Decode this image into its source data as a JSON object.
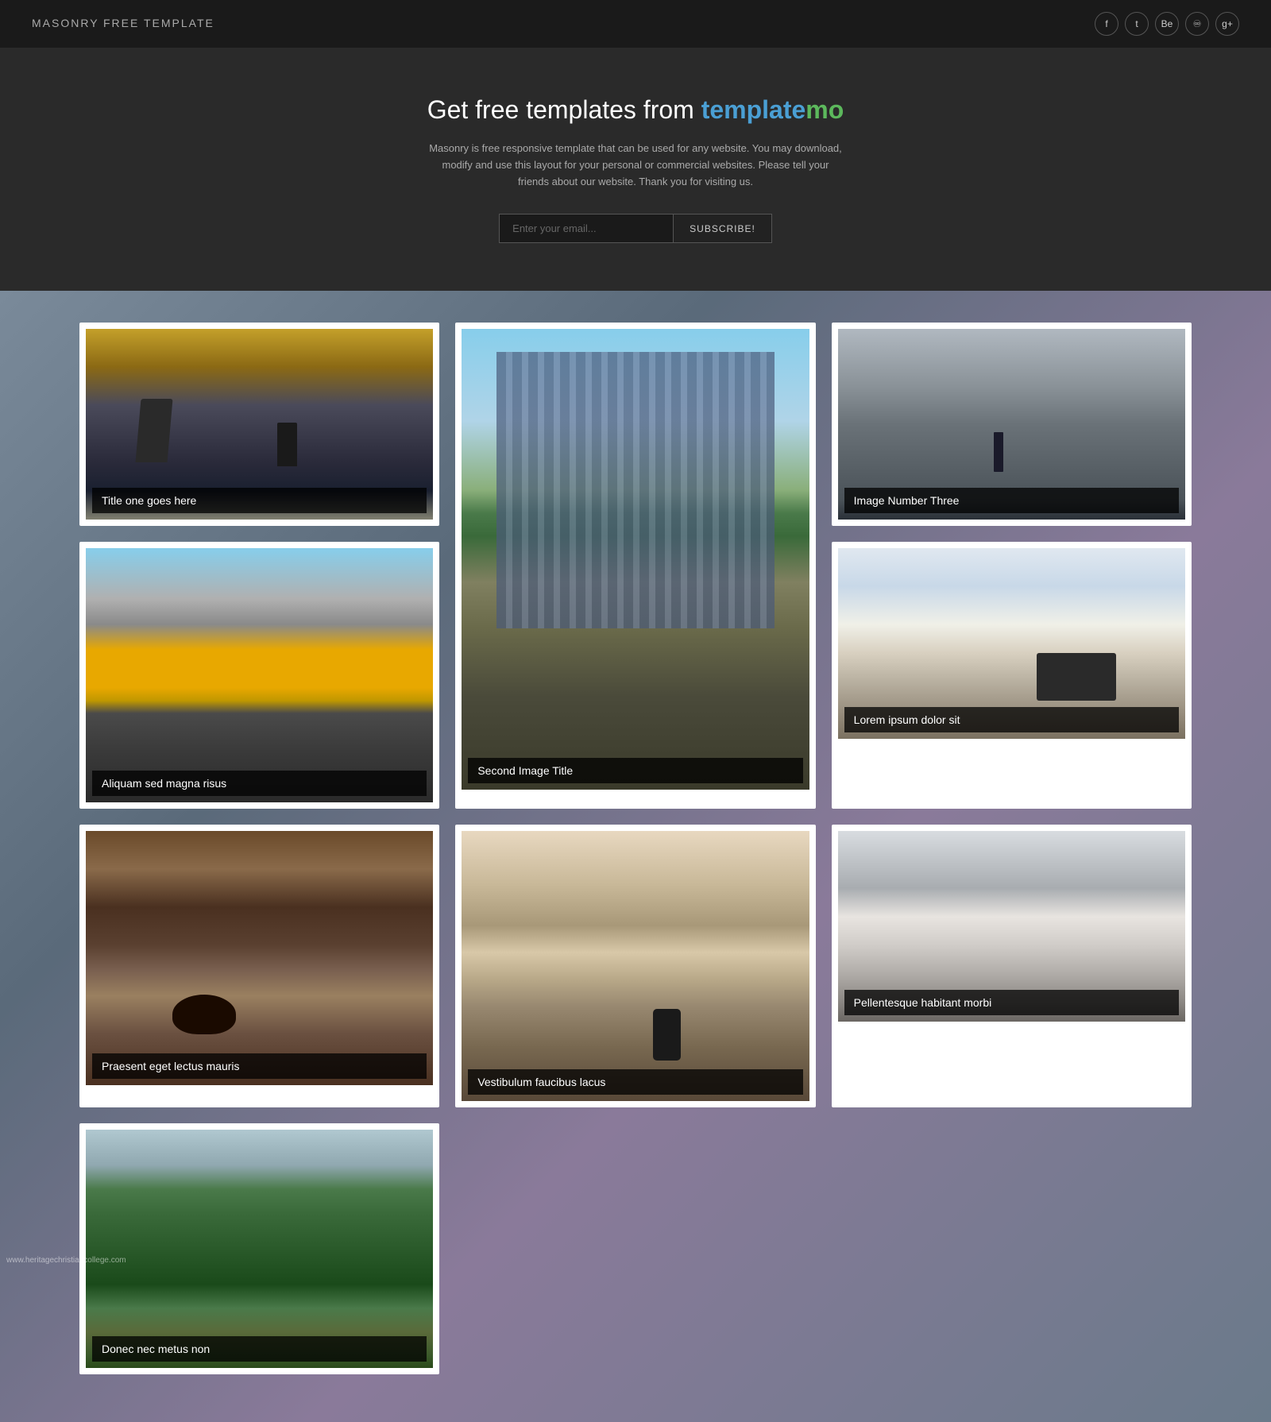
{
  "navbar": {
    "brand": "MASONRY",
    "brand_sub": "FREE TEMPLATE",
    "social": [
      {
        "icon": "f",
        "name": "facebook"
      },
      {
        "icon": "t",
        "name": "twitter"
      },
      {
        "icon": "Be",
        "name": "behance"
      },
      {
        "icon": "♾",
        "name": "pinterest"
      },
      {
        "icon": "g+",
        "name": "googleplus"
      }
    ]
  },
  "hero": {
    "title_prefix": "Get free templates from ",
    "brand_template": "template",
    "brand_mo": "mo",
    "description": "Masonry is free responsive template that can be used for any website. You may download, modify and use this layout for your personal or commercial websites. Please tell your friends about our website. Thank you for visiting us.",
    "email_placeholder": "Enter your email...",
    "subscribe_label": "SUBSCRIBE!"
  },
  "gallery": {
    "items": [
      {
        "id": "item-1",
        "title": "Title one goes here",
        "image_type": "ocean",
        "size": "normal"
      },
      {
        "id": "item-2",
        "title": "Second Image Title",
        "image_type": "city",
        "size": "tall"
      },
      {
        "id": "item-3",
        "title": "Image Number Three",
        "image_type": "graffiti",
        "size": "normal"
      },
      {
        "id": "item-4",
        "title": "Aliquam sed magna risus",
        "image_type": "taxis",
        "size": "normal"
      },
      {
        "id": "item-5",
        "title": "Lorem ipsum dolor sit",
        "image_type": "desk",
        "size": "normal"
      },
      {
        "id": "item-6",
        "title": "Praesent eget lectus mauris",
        "image_type": "coffee",
        "size": "normal"
      },
      {
        "id": "item-7",
        "title": "Donec nec metus non",
        "image_type": "forest",
        "size": "normal"
      },
      {
        "id": "item-8",
        "title": "Vestibulum faucibus lacus",
        "image_type": "phone",
        "size": "normal"
      },
      {
        "id": "item-9",
        "title": "Pellentesque habitant morbi",
        "image_type": "interior",
        "size": "normal"
      }
    ]
  },
  "footer": {
    "watermark": "www.heritagechristiancollege.com"
  }
}
